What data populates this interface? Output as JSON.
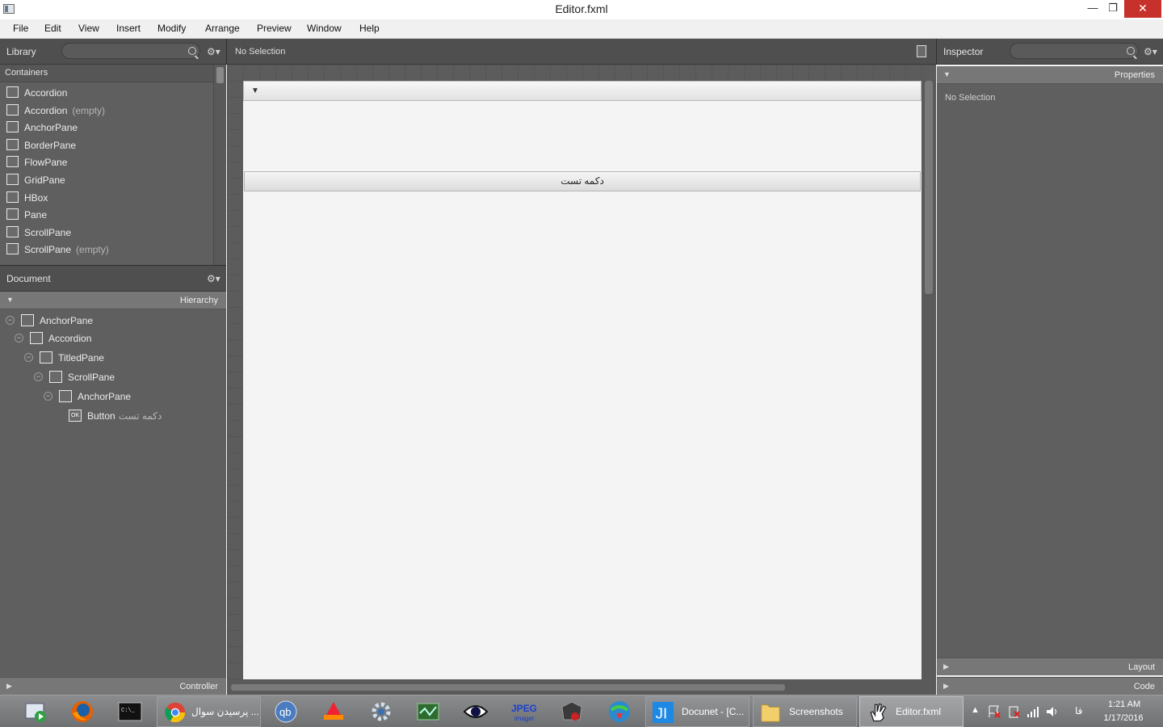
{
  "window": {
    "title": "Editor.fxml",
    "minimize": "—",
    "restore": "❐",
    "close": "✕"
  },
  "menu": [
    "File",
    "Edit",
    "View",
    "Insert",
    "Modify",
    "Arrange",
    "Preview",
    "Window",
    "Help"
  ],
  "library": {
    "label": "Library",
    "search_placeholder": "",
    "section": "Containers",
    "items": [
      {
        "name": "Accordion",
        "extra": ""
      },
      {
        "name": "Accordion",
        "extra": "(empty)"
      },
      {
        "name": "AnchorPane",
        "extra": ""
      },
      {
        "name": "BorderPane",
        "extra": ""
      },
      {
        "name": "FlowPane",
        "extra": ""
      },
      {
        "name": "GridPane",
        "extra": ""
      },
      {
        "name": "HBox",
        "extra": ""
      },
      {
        "name": "Pane",
        "extra": ""
      },
      {
        "name": "ScrollPane",
        "extra": ""
      },
      {
        "name": "ScrollPane",
        "extra": "(empty)"
      }
    ]
  },
  "document": {
    "label": "Document",
    "hierarchy_label": "Hierarchy",
    "tree": [
      {
        "name": "AnchorPane",
        "sub": ""
      },
      {
        "name": "Accordion",
        "sub": ""
      },
      {
        "name": "TitledPane",
        "sub": ""
      },
      {
        "name": "ScrollPane",
        "sub": ""
      },
      {
        "name": "AnchorPane",
        "sub": ""
      },
      {
        "name": "Button",
        "sub": "دکمه تست"
      }
    ],
    "controller_label": "Controller"
  },
  "content": {
    "selection": "No Selection",
    "button_text": "دکمه تست",
    "titled_arrow": "▼"
  },
  "inspector": {
    "label": "Inspector",
    "properties_label": "Properties",
    "no_selection": "No Selection",
    "layout_label": "Layout",
    "code_label": "Code"
  },
  "taskbar": {
    "buttons": [
      {
        "label": "پرسیدن سوال ..."
      },
      {
        "label": "Docunet - [C..."
      },
      {
        "label": "Screenshots"
      },
      {
        "label": "Editor.fxml"
      }
    ],
    "lang": "فا",
    "time": "1:21 AM",
    "date": "1/17/2016"
  }
}
